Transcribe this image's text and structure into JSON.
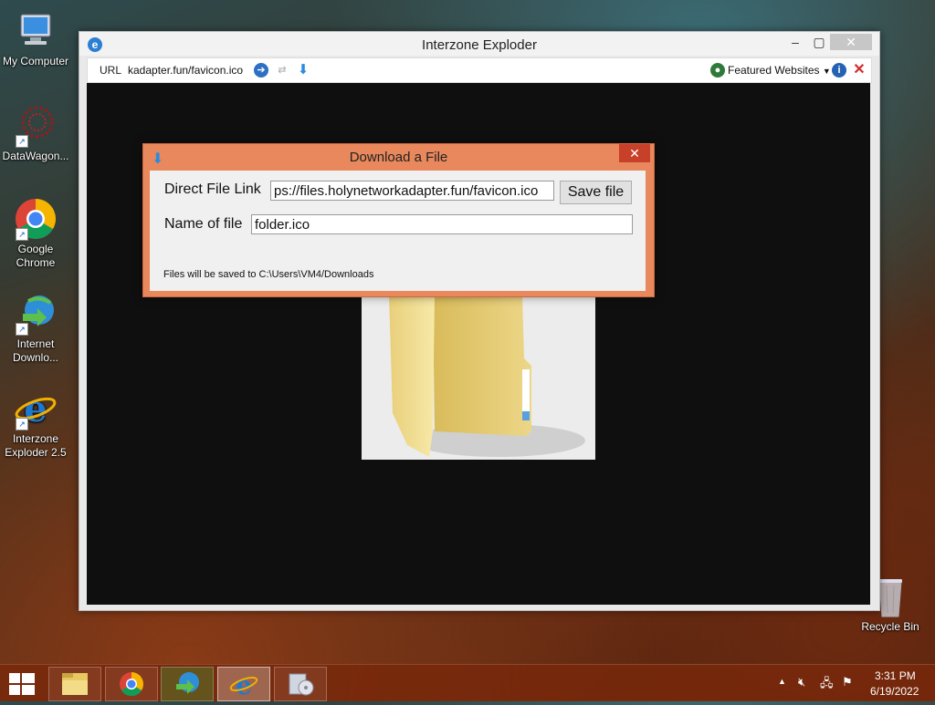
{
  "desktop": {
    "icons": [
      {
        "label_line1": "My Computer",
        "label_line2": ""
      },
      {
        "label_line1": "DataWagon...",
        "label_line2": ""
      },
      {
        "label_line1": "Google",
        "label_line2": "Chrome"
      },
      {
        "label_line1": "Internet",
        "label_line2": "Downlo..."
      },
      {
        "label_line1": "Interzone",
        "label_line2": "Exploder 2.5"
      }
    ],
    "recycle_bin": "Recycle Bin"
  },
  "window": {
    "title": "Interzone Exploder",
    "toolbar": {
      "url_label": "URL",
      "url_value": "kadapter.fun/favicon.ico",
      "featured": "Featured Websites"
    }
  },
  "dialog": {
    "title": "Download a File",
    "direct_link_label": "Direct File Link",
    "direct_link_value": "ps://files.holynetworkadapter.fun/favicon.ico",
    "save_button": "Save file",
    "name_label": "Name of file",
    "name_value": "folder.ico",
    "note": "Files will be saved to C:\\Users\\VM4/Downloads"
  },
  "taskbar": {
    "time": "3:31 PM",
    "date": "6/19/2022"
  },
  "colors": {
    "dialog_frame": "#e8885c",
    "taskbar": "#78280a",
    "browser_content": "#0f0f0f"
  }
}
